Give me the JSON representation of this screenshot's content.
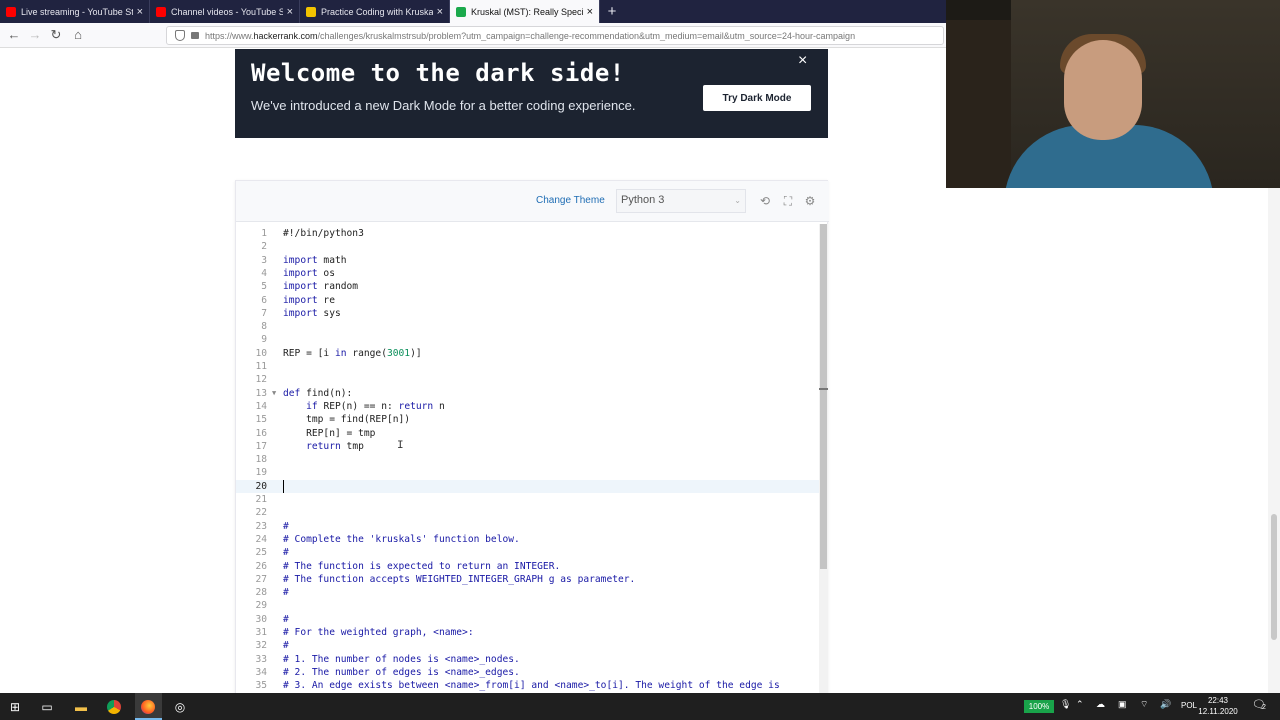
{
  "browser": {
    "tabs": [
      {
        "title": "Live streaming - YouTube Studio",
        "fav_color": "#ff0000",
        "active": false
      },
      {
        "title": "Channel videos - YouTube Studio",
        "fav_color": "#ff0000",
        "active": false
      },
      {
        "title": "Practice Coding with Kruskal (MST)",
        "fav_color": "#f3c400",
        "active": false
      },
      {
        "title": "Kruskal (MST): Really Special Subtree",
        "fav_color": "#1ba94c",
        "active": true
      }
    ],
    "new_tab_label": "+",
    "url_prefix": "https://www.",
    "url_domain": "hackerrank.com",
    "url_rest": "/challenges/kruskalmstrsub/problem?utm_campaign=challenge-recommendation&utm_medium=email&utm_source=24-hour-campaign"
  },
  "banner": {
    "title": "Welcome to the dark side!",
    "subtitle": "We've introduced a new Dark Mode for a better coding experience.",
    "button": "Try Dark Mode",
    "close": "×"
  },
  "editor": {
    "change_theme": "Change Theme",
    "language": "Python 3",
    "current_line": 20,
    "lines": [
      {
        "n": "1",
        "segs": [
          [
            "#!/bin/python3",
            ""
          ]
        ]
      },
      {
        "n": "2",
        "segs": []
      },
      {
        "n": "3",
        "segs": [
          [
            "import",
            "kw"
          ],
          [
            " math",
            ""
          ]
        ]
      },
      {
        "n": "4",
        "segs": [
          [
            "import",
            "kw"
          ],
          [
            " os",
            ""
          ]
        ]
      },
      {
        "n": "5",
        "segs": [
          [
            "import",
            "kw"
          ],
          [
            " random",
            ""
          ]
        ]
      },
      {
        "n": "6",
        "segs": [
          [
            "import",
            "kw"
          ],
          [
            " re",
            ""
          ]
        ]
      },
      {
        "n": "7",
        "segs": [
          [
            "import",
            "kw"
          ],
          [
            " sys",
            ""
          ]
        ]
      },
      {
        "n": "8",
        "segs": []
      },
      {
        "n": "9",
        "segs": []
      },
      {
        "n": "10",
        "segs": [
          [
            "REP = [i ",
            ""
          ],
          [
            "in",
            "kw"
          ],
          [
            " range(",
            ""
          ],
          [
            "3001",
            "num"
          ],
          [
            ")]",
            ""
          ]
        ]
      },
      {
        "n": "11",
        "segs": []
      },
      {
        "n": "12",
        "segs": []
      },
      {
        "n": "13",
        "fold": true,
        "segs": [
          [
            "def",
            "kw"
          ],
          [
            " find(n):",
            ""
          ]
        ]
      },
      {
        "n": "14",
        "segs": [
          [
            "    ",
            ""
          ],
          [
            "if",
            "kw"
          ],
          [
            " REP(n) == n: ",
            ""
          ],
          [
            "return",
            "kw"
          ],
          [
            " n",
            ""
          ]
        ]
      },
      {
        "n": "15",
        "segs": [
          [
            "    tmp = find(REP[n])",
            ""
          ]
        ]
      },
      {
        "n": "16",
        "segs": [
          [
            "    REP[n] = tmp",
            ""
          ]
        ]
      },
      {
        "n": "17",
        "segs": [
          [
            "    ",
            ""
          ],
          [
            "return",
            "kw"
          ],
          [
            " tmp",
            ""
          ]
        ]
      },
      {
        "n": "18",
        "segs": []
      },
      {
        "n": "19",
        "segs": []
      },
      {
        "n": "20",
        "segs": []
      },
      {
        "n": "21",
        "segs": []
      },
      {
        "n": "22",
        "segs": []
      },
      {
        "n": "23",
        "segs": [
          [
            "#",
            "cm"
          ]
        ]
      },
      {
        "n": "24",
        "segs": [
          [
            "# Complete the 'kruskals' function below.",
            "cm"
          ]
        ]
      },
      {
        "n": "25",
        "segs": [
          [
            "#",
            "cm"
          ]
        ]
      },
      {
        "n": "26",
        "segs": [
          [
            "# The function is expected to return an INTEGER.",
            "cm"
          ]
        ]
      },
      {
        "n": "27",
        "segs": [
          [
            "# The function accepts WEIGHTED_INTEGER_GRAPH g as parameter.",
            "cm"
          ]
        ]
      },
      {
        "n": "28",
        "segs": [
          [
            "#",
            "cm"
          ]
        ]
      },
      {
        "n": "29",
        "segs": []
      },
      {
        "n": "30",
        "segs": [
          [
            "#",
            "cm"
          ]
        ]
      },
      {
        "n": "31",
        "segs": [
          [
            "# For the weighted graph, <name>:",
            "cm"
          ]
        ]
      },
      {
        "n": "32",
        "segs": [
          [
            "#",
            "cm"
          ]
        ]
      },
      {
        "n": "33",
        "segs": [
          [
            "# 1. The number of nodes is <name>_nodes.",
            "cm"
          ]
        ]
      },
      {
        "n": "34",
        "segs": [
          [
            "# 2. The number of edges is <name>_edges.",
            "cm"
          ]
        ]
      },
      {
        "n": "35",
        "segs": [
          [
            "# 3. An edge exists between <name>_from[i] and <name>_to[i]. The weight of the edge is",
            "cm"
          ]
        ]
      }
    ]
  },
  "taskbar": {
    "battery": "100%",
    "language": "POL",
    "time": "22:43",
    "date": "12.11.2020",
    "notifications": "2"
  }
}
